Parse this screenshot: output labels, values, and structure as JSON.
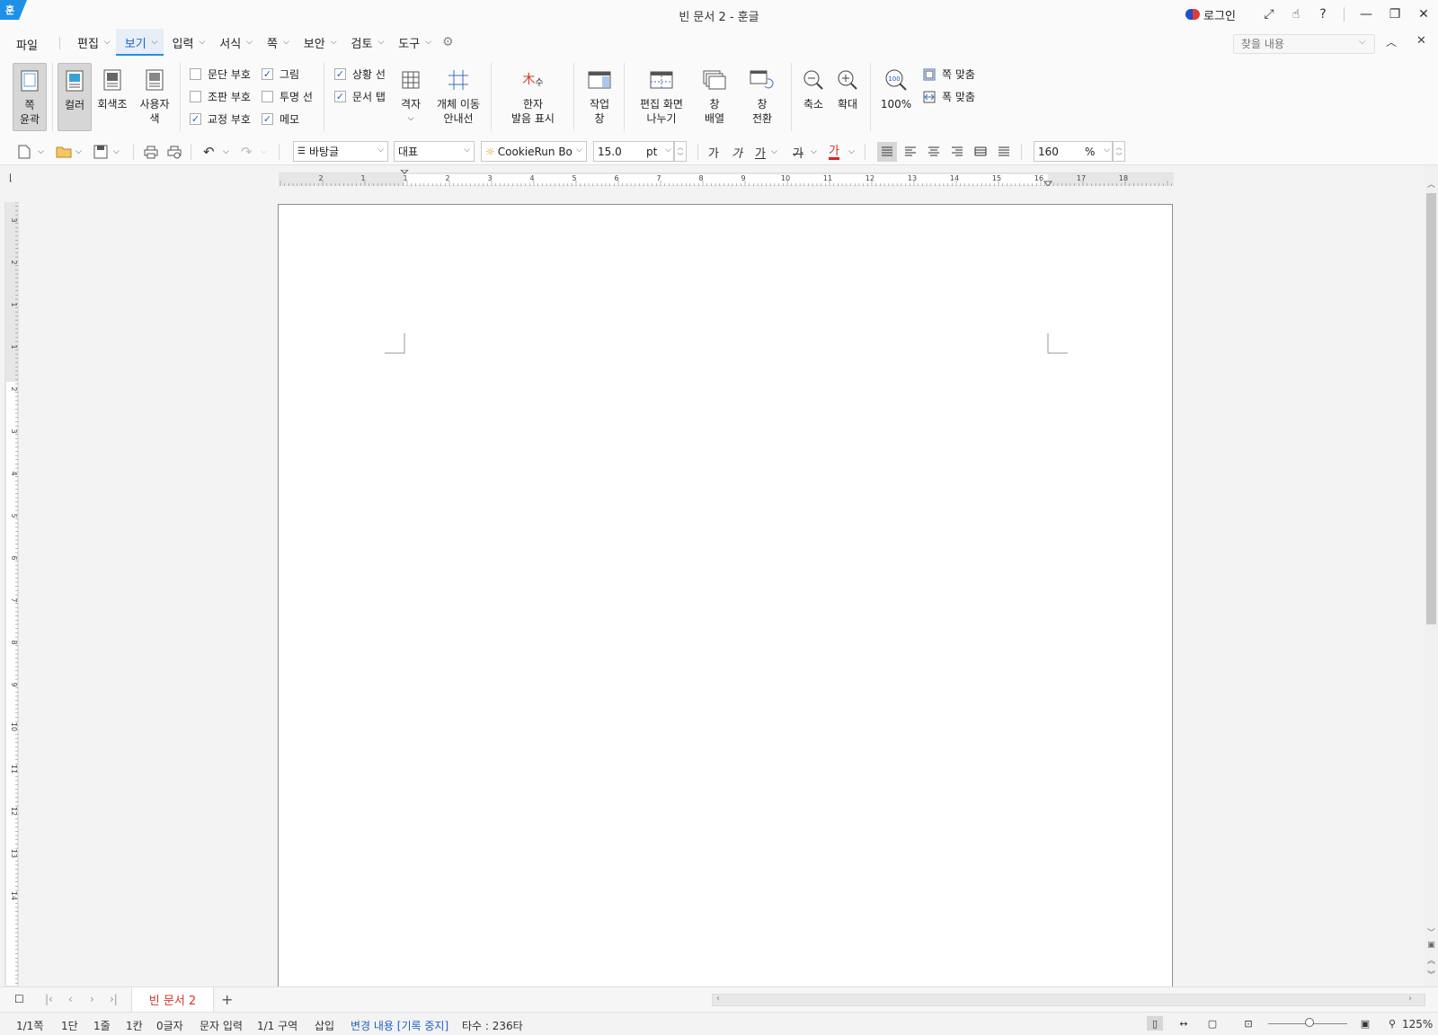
{
  "titlebar": {
    "title": "빈 문서 2 - 훈글",
    "app_logo": "훈",
    "login_label": "로그인",
    "icons": [
      "expand-icon",
      "touch-icon",
      "help-icon"
    ],
    "win_buttons": [
      "minimize",
      "restore",
      "close"
    ]
  },
  "menu": {
    "file": "파일",
    "tabs": [
      "편집",
      "보기",
      "입력",
      "서식",
      "쪽",
      "보안",
      "검토",
      "도구"
    ],
    "active_tab": "보기",
    "search_placeholder": "찾을 내용"
  },
  "ribbon": {
    "page_outline": [
      "쪽",
      "윤곽"
    ],
    "color_modes": {
      "color": "컬러",
      "gray": "회색조",
      "custom": [
        "사용자",
        "색"
      ]
    },
    "checks": [
      {
        "label": "문단 부호",
        "checked": false
      },
      {
        "label": "그림",
        "checked": true
      },
      {
        "label": "조판 부호",
        "checked": false
      },
      {
        "label": "투명 선",
        "checked": false
      },
      {
        "label": "교정 부호",
        "checked": true
      },
      {
        "label": "메모",
        "checked": true
      },
      {
        "label": "상황 선",
        "checked": true
      },
      {
        "label": "문서 탭",
        "checked": true
      }
    ],
    "grid": "격자",
    "object_move": [
      "개체 이동",
      "안내선"
    ],
    "hanja": [
      "한자",
      "발음 표시"
    ],
    "task_pane": [
      "작업",
      "창"
    ],
    "split_view": [
      "편집 화면",
      "나누기"
    ],
    "window_arrange": [
      "창",
      "배열"
    ],
    "window_switch": [
      "창",
      "전환"
    ],
    "zoom_out": "축소",
    "zoom_in": "확대",
    "zoom_100": "100%",
    "fit_page": "쪽 맞춤",
    "fit_width": "폭 맞춤"
  },
  "format": {
    "style": "바탕글",
    "language": "대표",
    "font": "CookieRun Bo",
    "size": "15.0",
    "unit": "pt",
    "line_spacing": "160",
    "line_unit": "%",
    "text_styles": [
      "가",
      "가",
      "가",
      "가",
      "가"
    ]
  },
  "ruler": {
    "h_numbers": [
      "2",
      "1",
      "1",
      "2",
      "3",
      "4",
      "5",
      "6",
      "7",
      "8",
      "9",
      "10",
      "11",
      "12",
      "13",
      "14",
      "15",
      "16",
      "17",
      "18"
    ],
    "v_numbers": [
      "3",
      "2",
      "1",
      "1",
      "2",
      "3",
      "4",
      "5",
      "6",
      "7",
      "8",
      "9",
      "10",
      "11",
      "12",
      "13",
      "14"
    ]
  },
  "tabs": {
    "document_tab": "빈 문서 2",
    "add": "+"
  },
  "status": {
    "page": "1/1쪽",
    "column": "1단",
    "line": "1줄",
    "cell": "1칸",
    "chars": "0글자",
    "mode": "문자 입력",
    "section": "1/1 구역",
    "insert": "삽입",
    "track": "변경 내용 [기록 중지]",
    "keystrokes": "타수 : 236타",
    "zoom": "125%"
  },
  "colors": {
    "accent": "#1e90e8",
    "active_tab_text": "#1565d8",
    "doc_tab_text": "#d8352a",
    "track_text": "#1e60c8"
  }
}
